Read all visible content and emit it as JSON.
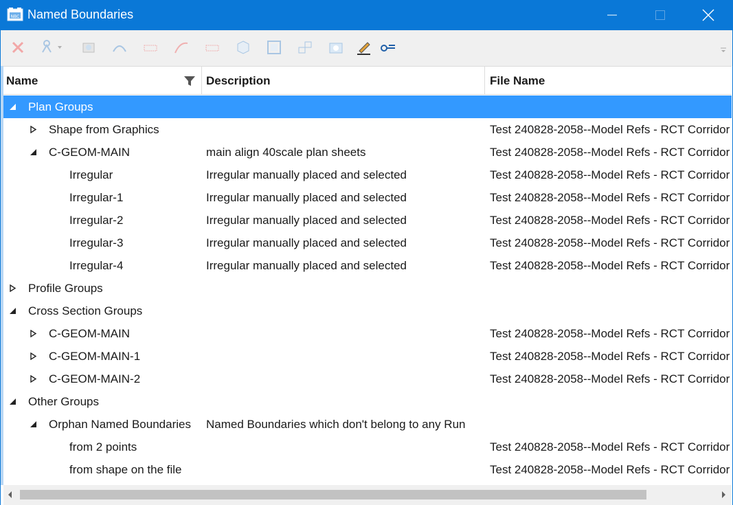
{
  "window": {
    "title": "Named Boundaries",
    "app_icon": "named-boundaries-app-icon",
    "controls": [
      "minimize-icon",
      "maximize-icon",
      "close-icon"
    ]
  },
  "toolbar": {
    "buttons": [
      {
        "name": "delete-button",
        "icon": "delete-x-icon",
        "enabled": false
      },
      {
        "name": "select-dropdown-button",
        "icon": "select-tool-icon",
        "enabled": false
      },
      {
        "name": "civil-plan-button",
        "icon": "civil-icon",
        "enabled": false
      },
      {
        "name": "profile-button",
        "icon": "profile-icon",
        "enabled": false
      },
      {
        "name": "grid-button",
        "icon": "grid-icon",
        "enabled": false
      },
      {
        "name": "curve-button",
        "icon": "curve-icon",
        "enabled": false
      },
      {
        "name": "grid2-button",
        "icon": "grid-icon",
        "enabled": false
      },
      {
        "name": "3d-model-button",
        "icon": "cube-icon",
        "enabled": false
      },
      {
        "name": "fit-view-button",
        "icon": "fit-view-icon",
        "enabled": false
      },
      {
        "name": "group-button",
        "icon": "group-icon",
        "enabled": false
      },
      {
        "name": "info-button",
        "icon": "info-icon",
        "enabled": false
      },
      {
        "name": "edit-button",
        "icon": "pencil-icon",
        "enabled": true
      },
      {
        "name": "key-button",
        "icon": "key-icon",
        "enabled": true
      }
    ]
  },
  "columns": {
    "name": "Name",
    "description": "Description",
    "file_name": "File Name"
  },
  "rows": [
    {
      "level": 0,
      "toggle": "expanded",
      "name": "Plan Groups",
      "description": "",
      "file": "",
      "selected": true
    },
    {
      "level": 1,
      "toggle": "collapsed",
      "name": "Shape from Graphics",
      "description": "",
      "file": "Test 240828-2058--Model Refs - RCT Corridor",
      "selected": false
    },
    {
      "level": 1,
      "toggle": "expanded",
      "name": "C-GEOM-MAIN",
      "description": "main align 40scale plan sheets",
      "file": "Test 240828-2058--Model Refs - RCT Corridor",
      "selected": false
    },
    {
      "level": 2,
      "toggle": "none",
      "name": "Irregular",
      "description": "Irregular manually placed and selected",
      "file": "Test 240828-2058--Model Refs - RCT Corridor",
      "selected": false
    },
    {
      "level": 2,
      "toggle": "none",
      "name": "Irregular-1",
      "description": "Irregular manually placed and selected",
      "file": "Test 240828-2058--Model Refs - RCT Corridor",
      "selected": false
    },
    {
      "level": 2,
      "toggle": "none",
      "name": "Irregular-2",
      "description": "Irregular manually placed and selected",
      "file": "Test 240828-2058--Model Refs - RCT Corridor",
      "selected": false
    },
    {
      "level": 2,
      "toggle": "none",
      "name": "Irregular-3",
      "description": "Irregular manually placed and selected",
      "file": "Test 240828-2058--Model Refs - RCT Corridor",
      "selected": false
    },
    {
      "level": 2,
      "toggle": "none",
      "name": "Irregular-4",
      "description": "Irregular manually placed and selected",
      "file": "Test 240828-2058--Model Refs - RCT Corridor",
      "selected": false
    },
    {
      "level": 0,
      "toggle": "collapsed",
      "name": "Profile Groups",
      "description": "",
      "file": "",
      "selected": false
    },
    {
      "level": 0,
      "toggle": "expanded",
      "name": "Cross Section Groups",
      "description": "",
      "file": "",
      "selected": false
    },
    {
      "level": 1,
      "toggle": "collapsed",
      "name": "C-GEOM-MAIN",
      "description": "",
      "file": "Test 240828-2058--Model Refs - RCT Corridor",
      "selected": false
    },
    {
      "level": 1,
      "toggle": "collapsed",
      "name": "C-GEOM-MAIN-1",
      "description": "",
      "file": "Test 240828-2058--Model Refs - RCT Corridor",
      "selected": false
    },
    {
      "level": 1,
      "toggle": "collapsed",
      "name": "C-GEOM-MAIN-2",
      "description": "",
      "file": "Test 240828-2058--Model Refs - RCT Corridor",
      "selected": false
    },
    {
      "level": 0,
      "toggle": "expanded",
      "name": "Other Groups",
      "description": "",
      "file": "",
      "selected": false
    },
    {
      "level": 1,
      "toggle": "expanded",
      "name": "Orphan Named Boundaries",
      "description": "Named Boundaries which don't belong to any Run",
      "file": "",
      "selected": false
    },
    {
      "level": 2,
      "toggle": "none",
      "name": "from 2 points",
      "description": "",
      "file": "Test 240828-2058--Model Refs - RCT Corridor",
      "selected": false
    },
    {
      "level": 2,
      "toggle": "none",
      "name": "from shape on the file",
      "description": "",
      "file": "Test 240828-2058--Model Refs - RCT Corridor",
      "selected": false
    }
  ],
  "colors": {
    "titlebar": "#0a78d7",
    "selection": "#3399ff"
  }
}
